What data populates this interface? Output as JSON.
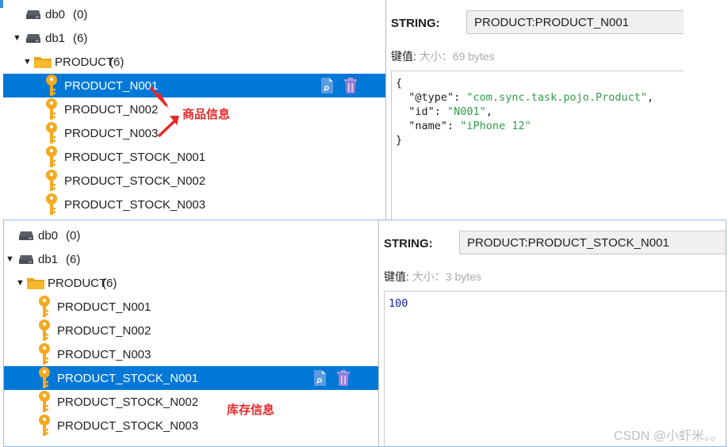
{
  "top": {
    "tree": {
      "dbs": [
        {
          "label": "db0",
          "count": "(0)",
          "expanded": false
        },
        {
          "label": "db1",
          "count": "(6)",
          "expanded": true
        }
      ],
      "folder": {
        "label": "PRODUCT",
        "count": "(6)"
      },
      "keys": [
        "PRODUCT_N001",
        "PRODUCT_N002",
        "PRODUCT_N003",
        "PRODUCT_STOCK_N001",
        "PRODUCT_STOCK_N002",
        "PRODUCT_STOCK_N003"
      ],
      "selected_index": 0
    },
    "detail": {
      "type_label": "STRING:",
      "key_value": "PRODUCT:PRODUCT_N001",
      "value_label": "键值:",
      "size_label": "大小：69 bytes",
      "json_lines": [
        {
          "parts": [
            [
              "{",
              "plain"
            ]
          ]
        },
        {
          "parts": [
            [
              "  \"@type\"",
              "key"
            ],
            [
              ": ",
              "plain"
            ],
            [
              "\"com.sync.task.pojo.Product\"",
              "str"
            ],
            [
              ",",
              "plain"
            ]
          ]
        },
        {
          "parts": [
            [
              "  \"id\"",
              "key"
            ],
            [
              ": ",
              "plain"
            ],
            [
              "\"N001\"",
              "str"
            ],
            [
              ",",
              "plain"
            ]
          ]
        },
        {
          "parts": [
            [
              "  \"name\"",
              "key"
            ],
            [
              ": ",
              "plain"
            ],
            [
              "\"iPhone 12\"",
              "str"
            ]
          ]
        },
        {
          "parts": [
            [
              "}",
              "plain"
            ]
          ]
        }
      ]
    },
    "annotation": "商品信息"
  },
  "bottom": {
    "tree": {
      "dbs": [
        {
          "label": "db0",
          "count": "(0)",
          "expanded": false
        },
        {
          "label": "db1",
          "count": "(6)",
          "expanded": true
        }
      ],
      "folder": {
        "label": "PRODUCT",
        "count": "(6)"
      },
      "keys": [
        "PRODUCT_N001",
        "PRODUCT_N002",
        "PRODUCT_N003",
        "PRODUCT_STOCK_N001",
        "PRODUCT_STOCK_N002",
        "PRODUCT_STOCK_N003"
      ],
      "selected_index": 3
    },
    "detail": {
      "type_label": "STRING:",
      "key_value": "PRODUCT:PRODUCT_STOCK_N001",
      "value_label": "键值:",
      "size_label": "大小：3 bytes",
      "value_text": "100"
    },
    "annotation": "库存信息"
  },
  "icons": {
    "db": "database-icon",
    "folder": "folder-icon",
    "key": "key-icon",
    "copy": "copy-document-icon",
    "delete": "trash-icon"
  },
  "colors": {
    "selection": "#0078d7",
    "annotation": "#e52a2a",
    "json_string": "#2f9d4a",
    "number": "#1a1aa6"
  },
  "watermark": "CSDN @小虾米。。"
}
